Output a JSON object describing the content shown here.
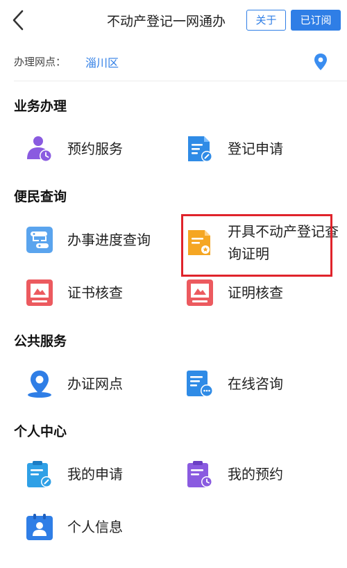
{
  "header": {
    "title": "不动产登记一网通办",
    "about_label": "关于",
    "subscribed_label": "已订阅"
  },
  "location": {
    "label": "办理网点：",
    "value": "淄川区"
  },
  "sections": {
    "business": {
      "title": "业务办理",
      "items": [
        "预约服务",
        "登记申请"
      ]
    },
    "query": {
      "title": "便民查询",
      "items": [
        "办事进度查询",
        "开具不动产登记查询证明",
        "证书核查",
        "证明核查"
      ]
    },
    "public": {
      "title": "公共服务",
      "items": [
        "办证网点",
        "在线咨询"
      ]
    },
    "personal": {
      "title": "个人中心",
      "items": [
        "我的申请",
        "我的预约",
        "个人信息"
      ]
    }
  },
  "colors": {
    "primary": "#2f7ee6",
    "highlight": "#e0232b",
    "purple": "#8a5be0",
    "red": "#ec5a5f",
    "orange": "#f5a623"
  }
}
